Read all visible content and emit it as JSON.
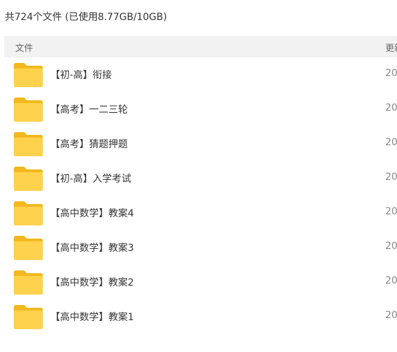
{
  "summary": "共724个文件 (已使用8.77GB/10GB)",
  "header": {
    "name_label": "文件",
    "date_label": "更新"
  },
  "files": [
    {
      "name": "【初-高】衔接",
      "date": "20",
      "icon": "folder-icon"
    },
    {
      "name": "【高考】一二三轮",
      "date": "20",
      "icon": "folder-icon"
    },
    {
      "name": "【高考】猜题押题",
      "date": "20",
      "icon": "folder-icon"
    },
    {
      "name": "【初-高】入学考试",
      "date": "20",
      "icon": "folder-icon"
    },
    {
      "name": "【高中数学】教案4",
      "date": "20",
      "icon": "folder-icon"
    },
    {
      "name": "【高中数学】教案3",
      "date": "20",
      "icon": "folder-icon"
    },
    {
      "name": "【高中数学】教案2",
      "date": "20",
      "icon": "folder-icon"
    },
    {
      "name": "【高中数学】教案1",
      "date": "20",
      "icon": "folder-icon"
    }
  ],
  "colors": {
    "folder_body": "#FFD24D",
    "folder_tab": "#F2B81E",
    "header_bg": "#F2F2F2"
  }
}
